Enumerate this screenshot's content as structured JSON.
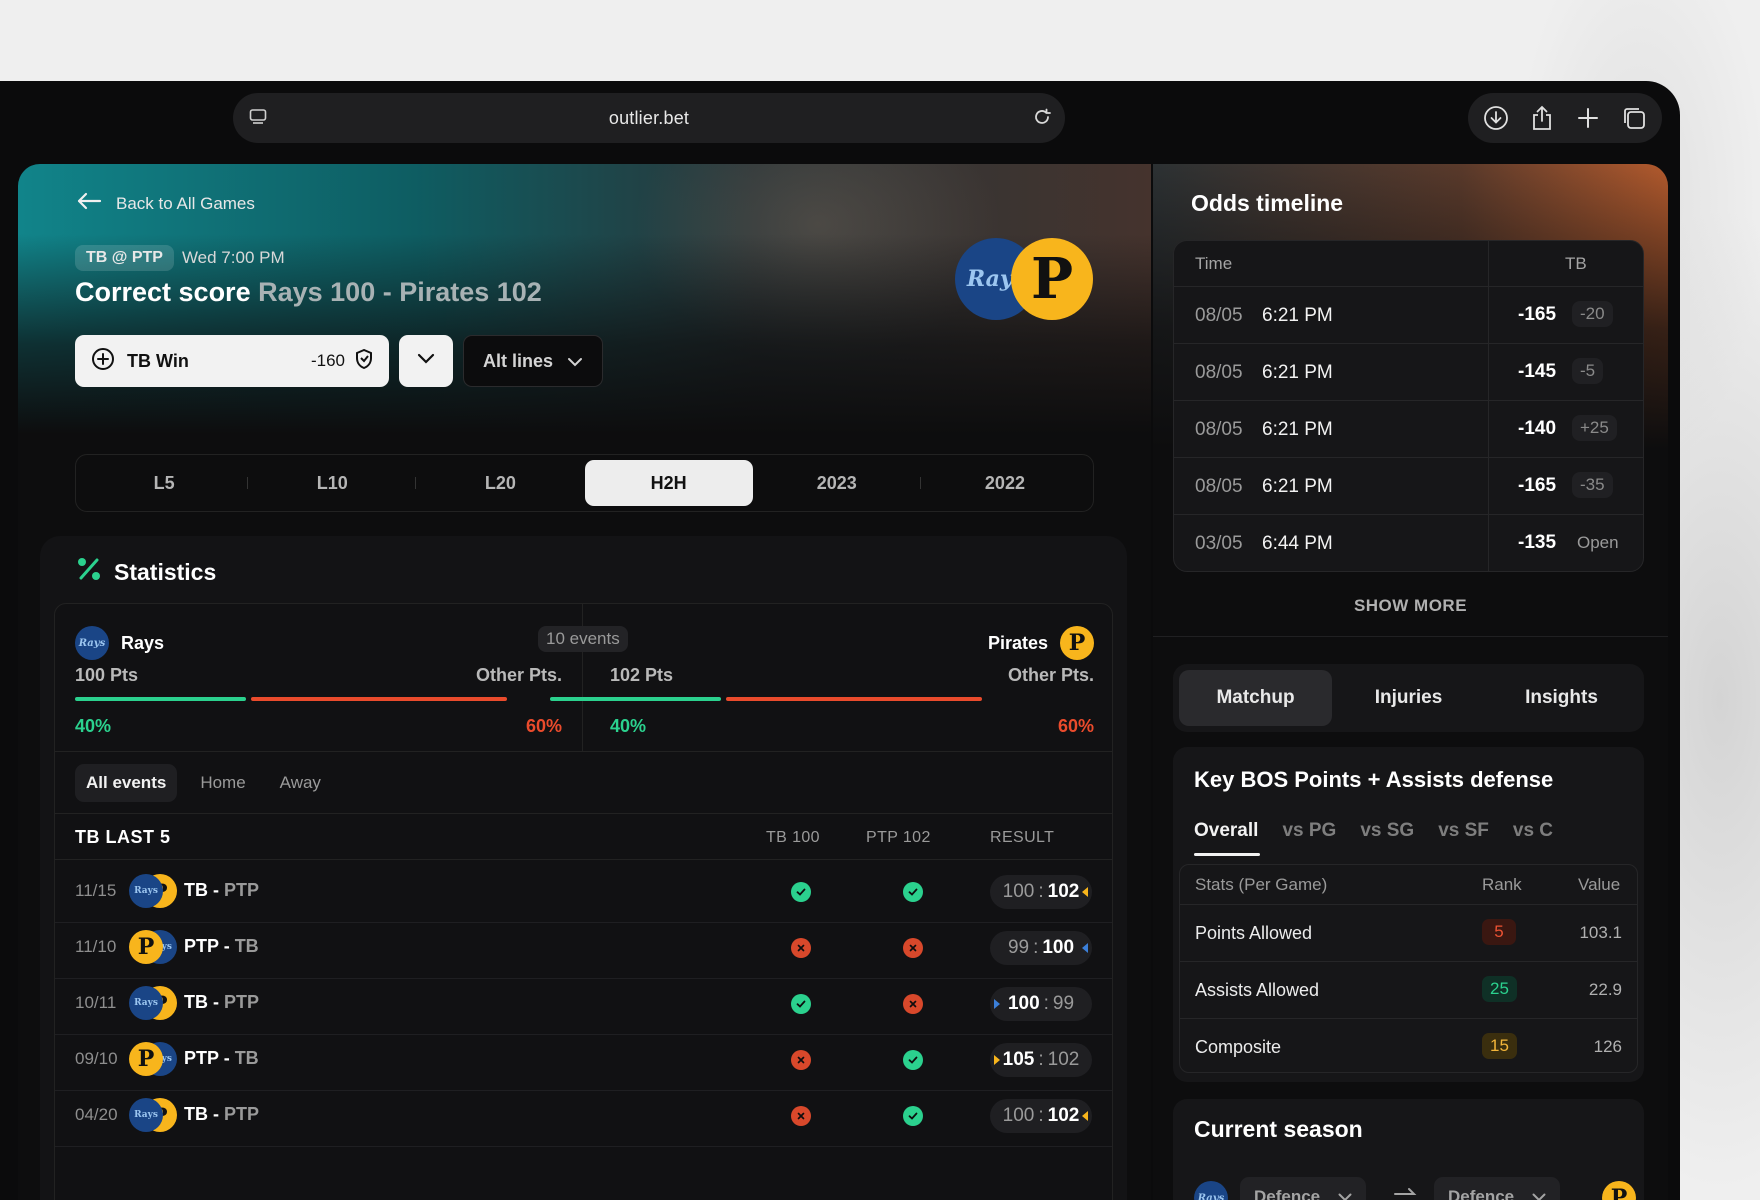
{
  "browser": {
    "url": "outlier.bet",
    "icons": [
      "tabs-icon",
      "reload-icon",
      "download-icon",
      "share-icon",
      "plus-icon",
      "tabs-overview-icon"
    ]
  },
  "hero": {
    "back_label": "Back to All Games",
    "matchup_chip": "TB @ PTP",
    "game_time": "Wed 7:00 PM",
    "title_prefix": "Correct score",
    "title_detail": "Rays 100 - Pirates 102",
    "bet_label": "TB Win",
    "bet_odds": "-160",
    "alt_lines_label": "Alt lines",
    "logo_rays_text": "Rays",
    "logo_pirates_text": "P"
  },
  "period_tabs": [
    "L5",
    "L10",
    "L20",
    "H2H",
    "2023",
    "2022"
  ],
  "period_active": "H2H",
  "statistics": {
    "title": "Statistics",
    "left_team": "Rays",
    "right_team": "Pirates",
    "events_count": "10 events",
    "left_pts": "100 Pts",
    "left_other": "Other Pts.",
    "left_pct_hit": "40%",
    "left_pct_miss": "60%",
    "right_pts": "102 Pts",
    "right_other": "Other Pts.",
    "right_pct_hit": "40%",
    "right_pct_miss": "60%",
    "hit_fraction": 0.4,
    "filters": [
      "All events",
      "Home",
      "Away"
    ],
    "filter_active": "All events",
    "table_title": "TB LAST 5",
    "col_tb": "TB 100",
    "col_ptp": "PTP 102",
    "col_result": "RESULT",
    "rows": [
      {
        "date": "11/15",
        "first": "TB",
        "sep": " - ",
        "second": "PTP",
        "tb_hit": true,
        "ptp_hit": true,
        "home_score": "100",
        "away_score": "102",
        "home_bold": false,
        "away_bold": true
      },
      {
        "date": "11/10",
        "first": "PTP",
        "sep": " - ",
        "second": "TB",
        "tb_hit": false,
        "ptp_hit": false,
        "home_score": "99",
        "away_score": "100",
        "home_bold": false,
        "away_bold": true
      },
      {
        "date": "10/11",
        "first": "TB",
        "sep": " - ",
        "second": "PTP",
        "tb_hit": true,
        "ptp_hit": false,
        "home_score": "100",
        "away_score": "99",
        "home_bold": true,
        "away_bold": false
      },
      {
        "date": "09/10",
        "first": "PTP",
        "sep": " - ",
        "second": "TB",
        "tb_hit": false,
        "ptp_hit": true,
        "home_score": "105",
        "away_score": "102",
        "home_bold": true,
        "away_bold": false
      },
      {
        "date": "04/20",
        "first": "TB",
        "sep": " - ",
        "second": "PTP",
        "tb_hit": false,
        "ptp_hit": true,
        "home_score": "100",
        "away_score": "102",
        "home_bold": false,
        "away_bold": true
      }
    ]
  },
  "odds_timeline": {
    "title": "Odds timeline",
    "col_time": "Time",
    "col_team": "TB",
    "rows": [
      {
        "date": "08/05",
        "time": "6:21 PM",
        "odds": "-165",
        "delta": "-20"
      },
      {
        "date": "08/05",
        "time": "6:21 PM",
        "odds": "-145",
        "delta": "-5"
      },
      {
        "date": "08/05",
        "time": "6:21 PM",
        "odds": "-140",
        "delta": "+25"
      },
      {
        "date": "08/05",
        "time": "6:21 PM",
        "odds": "-165",
        "delta": "-35"
      },
      {
        "date": "03/05",
        "time": "6:44 PM",
        "odds": "-135",
        "delta": "Open"
      }
    ],
    "show_more": "SHOW MORE"
  },
  "matchup_tabs": [
    "Matchup",
    "Injuries",
    "Insights"
  ],
  "matchup_active": "Matchup",
  "key_defense": {
    "title": "Key BOS Points + Assists defense",
    "tabs": [
      "Overall",
      "vs PG",
      "vs SG",
      "vs SF",
      "vs C"
    ],
    "tab_active": "Overall",
    "col_stat": "Stats (Per Game)",
    "col_rank": "Rank",
    "col_value": "Value",
    "rows": [
      {
        "stat": "Points Allowed",
        "rank": "5",
        "value": "103.1",
        "tone": "red"
      },
      {
        "stat": "Assists Allowed",
        "rank": "25",
        "value": "22.9",
        "tone": "green"
      },
      {
        "stat": "Composite",
        "rank": "15",
        "value": "126",
        "tone": "yellow"
      }
    ]
  },
  "current_season": {
    "title": "Current season",
    "left_select": "Defence",
    "right_select": "Defence"
  },
  "colors": {
    "green": "#2bd18e",
    "red": "#ea4b2c",
    "rays_blue": "#1a4586",
    "pirates_gold": "#f8b51c"
  }
}
